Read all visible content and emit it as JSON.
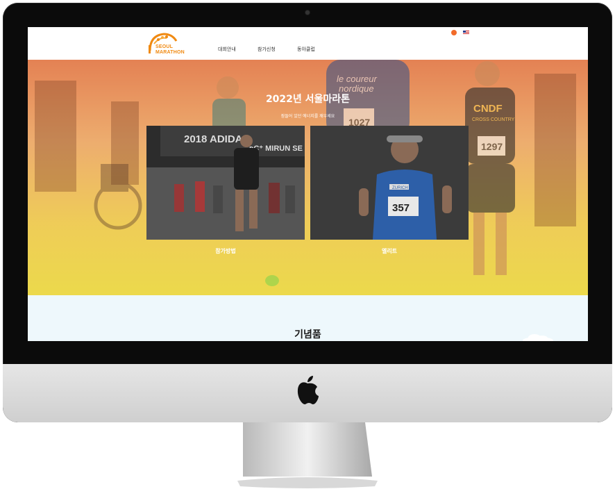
{
  "site": {
    "logo_text_line1": "SEOUL",
    "logo_text_line2": "MARATHON",
    "nav": [
      {
        "label": "대회안내"
      },
      {
        "label": "참가신청"
      },
      {
        "label": "동아클럽"
      }
    ]
  },
  "hero": {
    "title": "2022년 서울마라톤",
    "subtitle": "잠들어 있던 에너지를 깨우세요",
    "cards": [
      {
        "label": "참가방법",
        "photo_text": "2018 ADIDAS ᴅC⁺ MIRUN SE"
      },
      {
        "label": "엘리트",
        "photo_text": "ZURICH",
        "bib": "357"
      }
    ],
    "background_runner_text": [
      "le coureur",
      "nordique",
      "CNDF",
      "CROSS COUNTRY",
      "1297",
      "1027"
    ]
  },
  "lower_section": {
    "title": "기념품"
  },
  "colors": {
    "brand_orange": "#f08a12",
    "hero_top": "#e0703c",
    "hero_bottom": "#ead63c",
    "lower_bg": "#eef8fc"
  }
}
